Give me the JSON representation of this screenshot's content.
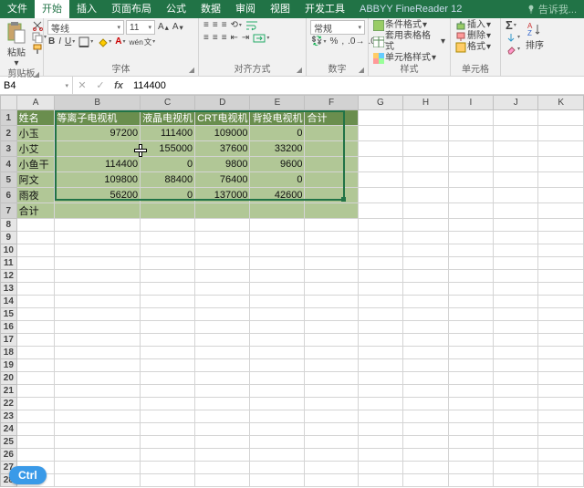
{
  "titlebar": {
    "tabs": [
      "文件",
      "开始",
      "插入",
      "页面布局",
      "公式",
      "数据",
      "审阅",
      "视图",
      "开发工具"
    ],
    "active": 1,
    "addon": "ABBYY FineReader 12",
    "tell_me": "告诉我..."
  },
  "ribbon": {
    "clipboard": {
      "label": "剪贴板",
      "paste": "粘贴"
    },
    "font": {
      "label": "字体",
      "name": "等线",
      "size": "11"
    },
    "alignment": {
      "label": "对齐方式"
    },
    "number": {
      "label": "数字",
      "format": "常规"
    },
    "styles": {
      "label": "样式",
      "conditional": "条件格式",
      "table": "套用表格格式",
      "cell": "单元格样式"
    },
    "cells": {
      "label": "单元格",
      "insert": "插入",
      "delete": "删除",
      "format": "格式"
    },
    "editing": {
      "sort": "排序"
    }
  },
  "formula_bar": {
    "name_box": "B4",
    "value": "114400"
  },
  "sheet": {
    "col_headers": [
      "A",
      "B",
      "C",
      "D",
      "E",
      "F",
      "G",
      "H",
      "I",
      "J",
      "K"
    ],
    "header_row": [
      "姓名",
      "等离子电视机",
      "液晶电视机",
      "CRT电视机",
      "背投电视机",
      "合计"
    ],
    "rows": [
      {
        "a": "小玉",
        "b": "97200",
        "c": "111400",
        "d": "109000",
        "e": "0",
        "f": ""
      },
      {
        "a": "小艾",
        "b": "",
        "c": "155000",
        "d": "37600",
        "e": "33200",
        "f": ""
      },
      {
        "a": "小鱼干",
        "b": "114400",
        "c": "0",
        "d": "9800",
        "e": "9600",
        "f": ""
      },
      {
        "a": "阿文",
        "b": "109800",
        "c": "88400",
        "d": "76400",
        "e": "0",
        "f": ""
      },
      {
        "a": "雨夜",
        "b": "56200",
        "c": "0",
        "d": "137000",
        "e": "42600",
        "f": ""
      },
      {
        "a": "合计",
        "b": "",
        "c": "",
        "d": "",
        "e": "",
        "f": ""
      }
    ],
    "selection": {
      "ref": "B4"
    }
  },
  "ctrl_badge": "Ctrl"
}
